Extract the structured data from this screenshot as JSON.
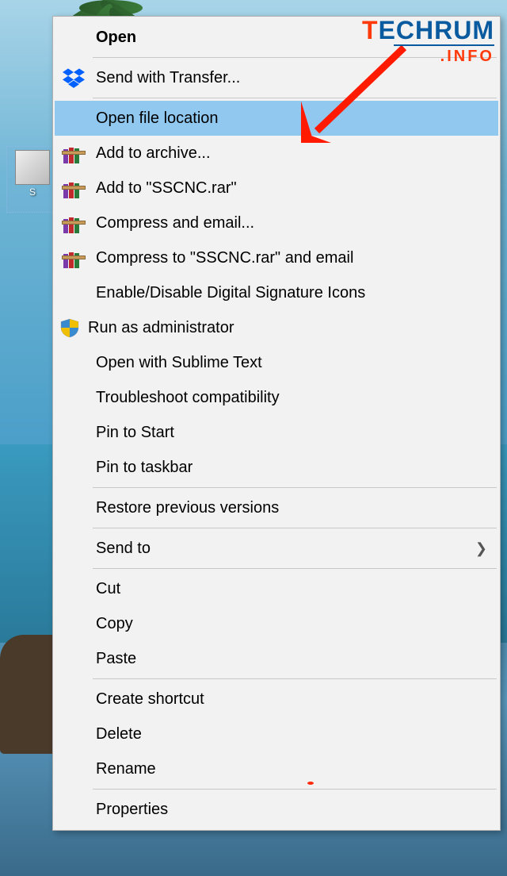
{
  "desktop": {
    "icon_label": "S"
  },
  "watermark": {
    "letter_t": "T",
    "rest": "ECHRUM",
    "sub": ".INFO"
  },
  "menu": {
    "open": "Open",
    "send_transfer": "Send with Transfer...",
    "open_location": "Open file location",
    "add_archive": "Add to archive...",
    "add_sscnc": "Add to \"SSCNC.rar\"",
    "compress_email": "Compress and email...",
    "compress_sscnc_email": "Compress to \"SSCNC.rar\" and email",
    "digital_sig": "Enable/Disable Digital Signature Icons",
    "run_admin": "Run as administrator",
    "open_sublime": "Open with Sublime Text",
    "troubleshoot": "Troubleshoot compatibility",
    "pin_start": "Pin to Start",
    "pin_taskbar": "Pin to taskbar",
    "restore_prev": "Restore previous versions",
    "send_to": "Send to",
    "cut": "Cut",
    "copy": "Copy",
    "paste": "Paste",
    "create_shortcut": "Create shortcut",
    "delete": "Delete",
    "rename": "Rename",
    "properties": "Properties"
  }
}
